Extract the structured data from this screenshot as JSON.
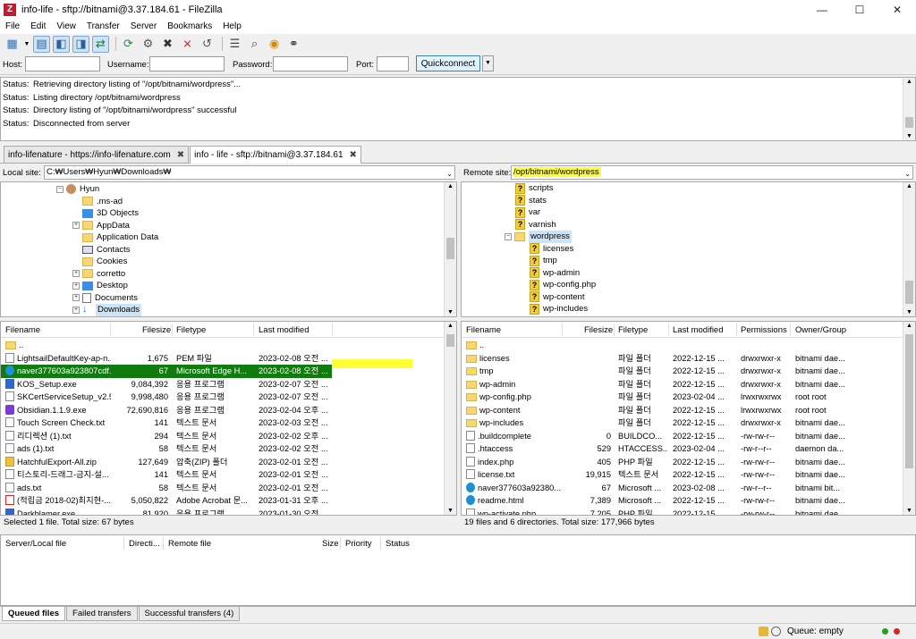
{
  "window": {
    "title": "info-life - sftp://bitnami@3.37.184.61 - FileZilla",
    "app_icon": "Z",
    "minimize": "—",
    "maximize": "☐",
    "close": "✕"
  },
  "menu": [
    "File",
    "Edit",
    "View",
    "Transfer",
    "Server",
    "Bookmarks",
    "Help"
  ],
  "quickconnect": {
    "host_label": "Host:",
    "username_label": "Username:",
    "password_label": "Password:",
    "port_label": "Port:",
    "button_label": "Quickconnect",
    "dropdown": "▼"
  },
  "log": [
    {
      "key": "Status:",
      "text": "Retrieving directory listing of \"/opt/bitnami/wordpress\"..."
    },
    {
      "key": "Status:",
      "text": "Listing directory /opt/bitnami/wordpress"
    },
    {
      "key": "Status:",
      "text": "Directory listing of \"/opt/bitnami/wordpress\" successful"
    },
    {
      "key": "Status:",
      "text": "Disconnected from server"
    }
  ],
  "tabs": [
    {
      "label": "info-lifenature - https://info-lifenature.com",
      "close": "✖"
    },
    {
      "label": "info - life - sftp://bitnami@3.37.184.61",
      "close": "✖"
    }
  ],
  "local": {
    "site_label": "Local site:",
    "path": "C:₩Users₩Hyun₩Downloads₩",
    "tree": [
      "Hyun",
      ".ms-ad",
      "3D Objects",
      "AppData",
      "Application Data",
      "Contacts",
      "Cookies",
      "corretto",
      "Desktop",
      "Documents",
      "Downloads"
    ],
    "headers": {
      "name": "Filename",
      "size": "Filesize",
      "type": "Filetype",
      "modified": "Last modified"
    },
    "rows": [
      {
        "name": "..",
        "size": "",
        "type": "",
        "modified": ""
      },
      {
        "name": "LightsailDefaultKey-ap-n...",
        "size": "1,675",
        "type": "PEM 파일",
        "modified": "2023-02-08 오전 ..."
      },
      {
        "name": "naver377603a923807cdf...",
        "size": "67",
        "type": "Microsoft Edge H...",
        "modified": "2023-02-08 오전 ..."
      },
      {
        "name": "KOS_Setup.exe",
        "size": "9,084,392",
        "type": "응용 프로그램",
        "modified": "2023-02-07 오전 ..."
      },
      {
        "name": "SKCertServiceSetup_v2.5...",
        "size": "9,998,480",
        "type": "응용 프로그램",
        "modified": "2023-02-07 오전 ..."
      },
      {
        "name": "Obsidian.1.1.9.exe",
        "size": "72,690,816",
        "type": "응용 프로그램",
        "modified": "2023-02-04 오후 ..."
      },
      {
        "name": "Touch Screen Check.txt",
        "size": "141",
        "type": "텍스트 문서",
        "modified": "2023-02-03 오전 ..."
      },
      {
        "name": "리디렉션 (1).txt",
        "size": "294",
        "type": "텍스트 문서",
        "modified": "2023-02-02 오후 ..."
      },
      {
        "name": "ads (1).txt",
        "size": "58",
        "type": "텍스트 문서",
        "modified": "2023-02-02 오전 ..."
      },
      {
        "name": "HatchfulExport-All.zip",
        "size": "127,649",
        "type": "압축(ZIP) 폴더",
        "modified": "2023-02-01 오전 ..."
      },
      {
        "name": "티스토리-드래그-금지-설...",
        "size": "141",
        "type": "텍스트 문서",
        "modified": "2023-02-01 오전 ..."
      },
      {
        "name": "ads.txt",
        "size": "58",
        "type": "텍스트 문서",
        "modified": "2023-02-01 오전 ..."
      },
      {
        "name": "(적립금 2018-02)최지현-...",
        "size": "5,050,822",
        "type": "Adobe Acrobat 문...",
        "modified": "2023-01-31 오후 ..."
      },
      {
        "name": "Darkblamer.exe",
        "size": "81,920",
        "type": "응용 프로그램",
        "modified": "2023-01-30 오전 ..."
      }
    ],
    "status": "Selected 1 file. Total size: 67 bytes"
  },
  "remote": {
    "site_label": "Remote site:",
    "path": "/opt/bitnami/wordpress",
    "tree": [
      "scripts",
      "stats",
      "var",
      "varnish",
      "wordpress",
      "licenses",
      "tmp",
      "wp-admin",
      "wp-config.php",
      "wp-content",
      "wp-includes"
    ],
    "headers": {
      "name": "Filename",
      "size": "Filesize",
      "type": "Filetype",
      "modified": "Last modified",
      "perms": "Permissions",
      "owner": "Owner/Group"
    },
    "rows": [
      {
        "name": "..",
        "size": "",
        "type": "",
        "modified": "",
        "perms": "",
        "owner": ""
      },
      {
        "name": "licenses",
        "size": "",
        "type": "파일 폴더",
        "modified": "2022-12-15 ...",
        "perms": "drwxrwxr-x",
        "owner": "bitnami dae..."
      },
      {
        "name": "tmp",
        "size": "",
        "type": "파일 폴더",
        "modified": "2022-12-15 ...",
        "perms": "drwxrwxr-x",
        "owner": "bitnami dae..."
      },
      {
        "name": "wp-admin",
        "size": "",
        "type": "파일 폴더",
        "modified": "2022-12-15 ...",
        "perms": "drwxrwxr-x",
        "owner": "bitnami dae..."
      },
      {
        "name": "wp-config.php",
        "size": "",
        "type": "파일 폴더",
        "modified": "2023-02-04 ...",
        "perms": "lrwxrwxrwx",
        "owner": "root root"
      },
      {
        "name": "wp-content",
        "size": "",
        "type": "파일 폴더",
        "modified": "2022-12-15 ...",
        "perms": "lrwxrwxrwx",
        "owner": "root root"
      },
      {
        "name": "wp-includes",
        "size": "",
        "type": "파일 폴더",
        "modified": "2022-12-15 ...",
        "perms": "drwxrwxr-x",
        "owner": "bitnami dae..."
      },
      {
        "name": ".buildcomplete",
        "size": "0",
        "type": "BUILDCO...",
        "modified": "2022-12-15 ...",
        "perms": "-rw-rw-r--",
        "owner": "bitnami dae..."
      },
      {
        "name": ".htaccess",
        "size": "529",
        "type": "HTACCESS...",
        "modified": "2023-02-04 ...",
        "perms": "-rw-r--r--",
        "owner": "daemon da..."
      },
      {
        "name": "index.php",
        "size": "405",
        "type": "PHP 파일",
        "modified": "2022-12-15 ...",
        "perms": "-rw-rw-r--",
        "owner": "bitnami dae..."
      },
      {
        "name": "license.txt",
        "size": "19,915",
        "type": "텍스트 문서",
        "modified": "2022-12-15 ...",
        "perms": "-rw-rw-r--",
        "owner": "bitnami dae..."
      },
      {
        "name": "naver377603a92380...",
        "size": "67",
        "type": "Microsoft ...",
        "modified": "2023-02-08 ...",
        "perms": "-rw-r--r--",
        "owner": "bitnami bit..."
      },
      {
        "name": "readme.html",
        "size": "7,389",
        "type": "Microsoft ...",
        "modified": "2022-12-15 ...",
        "perms": "-rw-rw-r--",
        "owner": "bitnami dae..."
      },
      {
        "name": "wp-activate.php",
        "size": "7,205",
        "type": "PHP 파일",
        "modified": "2022-12-15 ...",
        "perms": "-rw-rw-r--",
        "owner": "bitnami dae..."
      }
    ],
    "status": "19 files and 6 directories. Total size: 177,966 bytes"
  },
  "queue": {
    "headers": [
      "Server/Local file",
      "Directi...",
      "Remote file",
      "Size",
      "Priority",
      "Status"
    ],
    "tabs": [
      "Queued files",
      "Failed transfers",
      "Successful transfers (4)"
    ],
    "status": "Queue: empty"
  },
  "colors": {
    "selection": "#107c10",
    "highlight": "#ffff33",
    "accent": "#3c7fb1"
  }
}
